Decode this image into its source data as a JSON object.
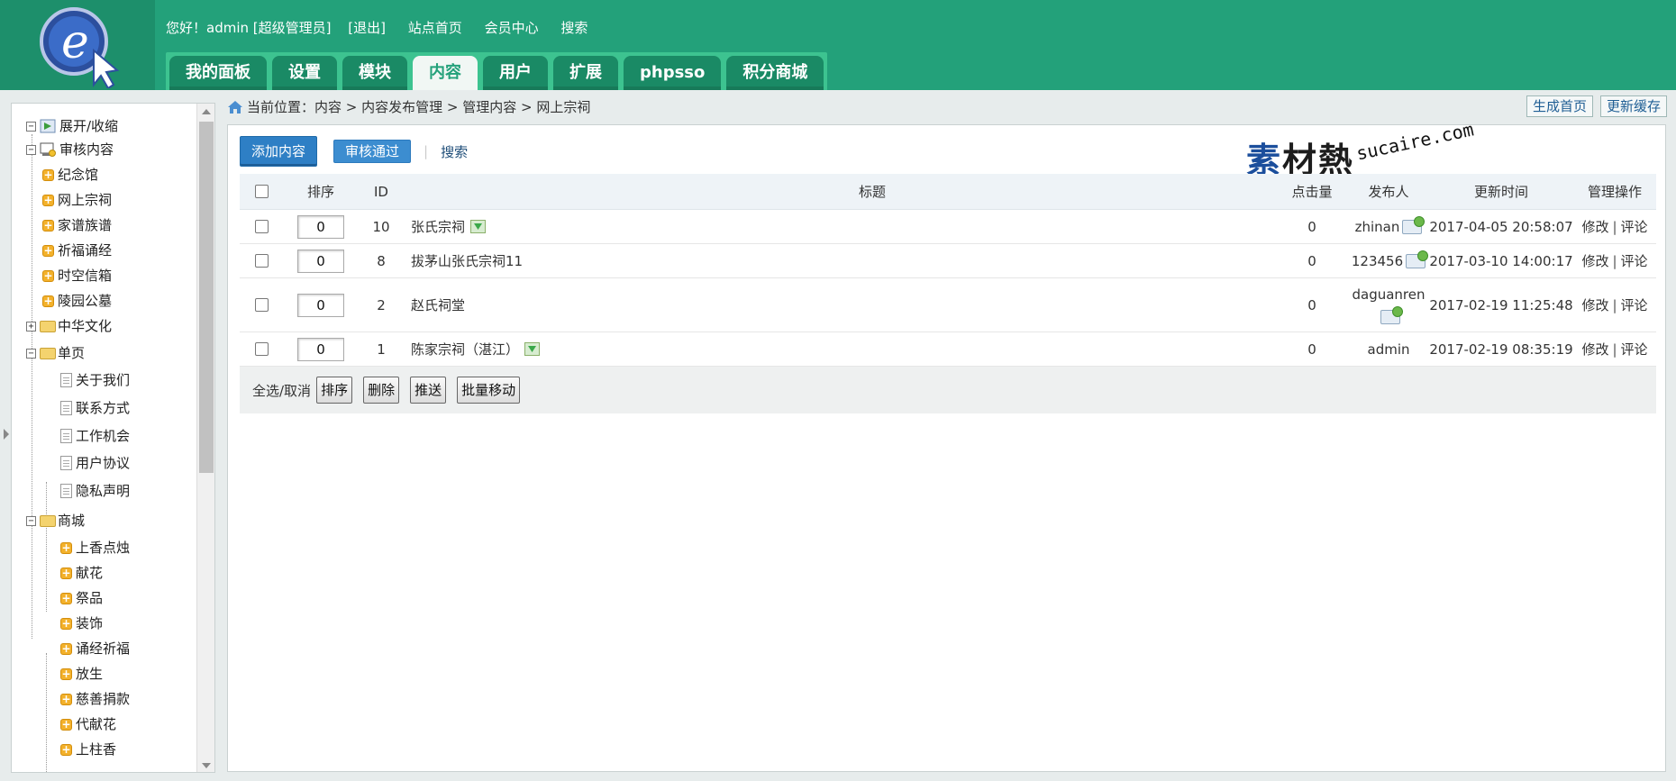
{
  "header": {
    "greeting": "您好！admin [超级管理员]",
    "logout": "[退出]",
    "links": [
      "站点首页",
      "会员中心",
      "搜索"
    ],
    "logo_letter": "e",
    "nav_tabs": [
      {
        "label": "我的面板",
        "active": false
      },
      {
        "label": "设置",
        "active": false
      },
      {
        "label": "模块",
        "active": false
      },
      {
        "label": "内容",
        "active": true
      },
      {
        "label": "用户",
        "active": false
      },
      {
        "label": "扩展",
        "active": false
      },
      {
        "label": "phpsso",
        "active": false
      },
      {
        "label": "积分商城",
        "active": false
      }
    ]
  },
  "sidebar": {
    "items": [
      {
        "label": "展开/收缩",
        "icon": "toggle-tree-icon",
        "toggle": "−"
      },
      {
        "label": "审核内容",
        "icon": "audit-icon",
        "toggle": "−"
      },
      {
        "label": "纪念馆",
        "icon": "plus-icon"
      },
      {
        "label": "网上宗祠",
        "icon": "plus-icon"
      },
      {
        "label": "家谱族谱",
        "icon": "plus-icon"
      },
      {
        "label": "祈福诵经",
        "icon": "plus-icon"
      },
      {
        "label": "时空信箱",
        "icon": "plus-icon"
      },
      {
        "label": "陵园公墓",
        "icon": "plus-icon"
      },
      {
        "label": "中华文化",
        "icon": "folder-icon",
        "toggle": "+"
      },
      {
        "label": "单页",
        "icon": "folder-open-icon",
        "toggle": "−"
      },
      {
        "label": "关于我们",
        "icon": "page-icon"
      },
      {
        "label": "联系方式",
        "icon": "page-icon"
      },
      {
        "label": "工作机会",
        "icon": "page-icon"
      },
      {
        "label": "用户协议",
        "icon": "page-icon"
      },
      {
        "label": "隐私声明",
        "icon": "page-icon"
      },
      {
        "label": "商城",
        "icon": "folder-open-icon",
        "toggle": "−"
      },
      {
        "label": "上香点烛",
        "icon": "plus-icon"
      },
      {
        "label": "献花",
        "icon": "plus-icon"
      },
      {
        "label": "祭品",
        "icon": "plus-icon"
      },
      {
        "label": "装饰",
        "icon": "plus-icon"
      },
      {
        "label": "诵经祈福",
        "icon": "plus-icon"
      },
      {
        "label": "放生",
        "icon": "plus-icon"
      },
      {
        "label": "慈善捐款",
        "icon": "plus-icon"
      },
      {
        "label": "代献花",
        "icon": "plus-icon"
      },
      {
        "label": "上柱香",
        "icon": "plus-icon"
      }
    ]
  },
  "breadcrumb": {
    "prefix": "当前位置：",
    "path": "内容 > 内容发布管理 > 管理内容 > 网上宗祠"
  },
  "top_buttons": {
    "generate_home": "生成首页",
    "update_cache": "更新缓存"
  },
  "actions": {
    "add": "添加内容",
    "audit_pass": "审核通过",
    "separator": "|",
    "search": "搜索"
  },
  "watermark": {
    "cn_first": "素",
    "cn_rest": "材熱",
    "en": "sucaire.com"
  },
  "table": {
    "headers": {
      "order": "排序",
      "id": "ID",
      "title": "标题",
      "hits": "点击量",
      "publisher": "发布人",
      "updated": "更新时间",
      "operations": "管理操作"
    },
    "rows": [
      {
        "order": "0",
        "id": "10",
        "title": "张氏宗祠",
        "has_thumb": true,
        "hits": "0",
        "publisher": "zhinan",
        "publisher_icon": true,
        "updated": "2017-04-05 20:58:07",
        "edit": "修改",
        "comment": "评论"
      },
      {
        "order": "0",
        "id": "8",
        "title": "拔茅山张氏宗祠11",
        "has_thumb": false,
        "hits": "0",
        "publisher": "123456",
        "publisher_icon": true,
        "updated": "2017-03-10 14:00:17",
        "edit": "修改",
        "comment": "评论"
      },
      {
        "order": "0",
        "id": "2",
        "title": "赵氏祠堂",
        "has_thumb": false,
        "hits": "0",
        "publisher": "daguanren",
        "publisher_icon": true,
        "updated": "2017-02-19 11:25:48",
        "edit": "修改",
        "comment": "评论"
      },
      {
        "order": "0",
        "id": "1",
        "title": "陈家宗祠（湛江）",
        "has_thumb": true,
        "hits": "0",
        "publisher": "admin",
        "publisher_icon": false,
        "updated": "2017-02-19 08:35:19",
        "edit": "修改",
        "comment": "评论"
      }
    ],
    "op_separator": "|"
  },
  "footer": {
    "select_all": "全选/取消",
    "buttons": [
      "排序",
      "删除",
      "推送",
      "批量移动"
    ]
  },
  "colors": {
    "header_bg": "#23a17a",
    "nav_active_text": "#23a17a",
    "primary_button": "#2e7fc5"
  }
}
